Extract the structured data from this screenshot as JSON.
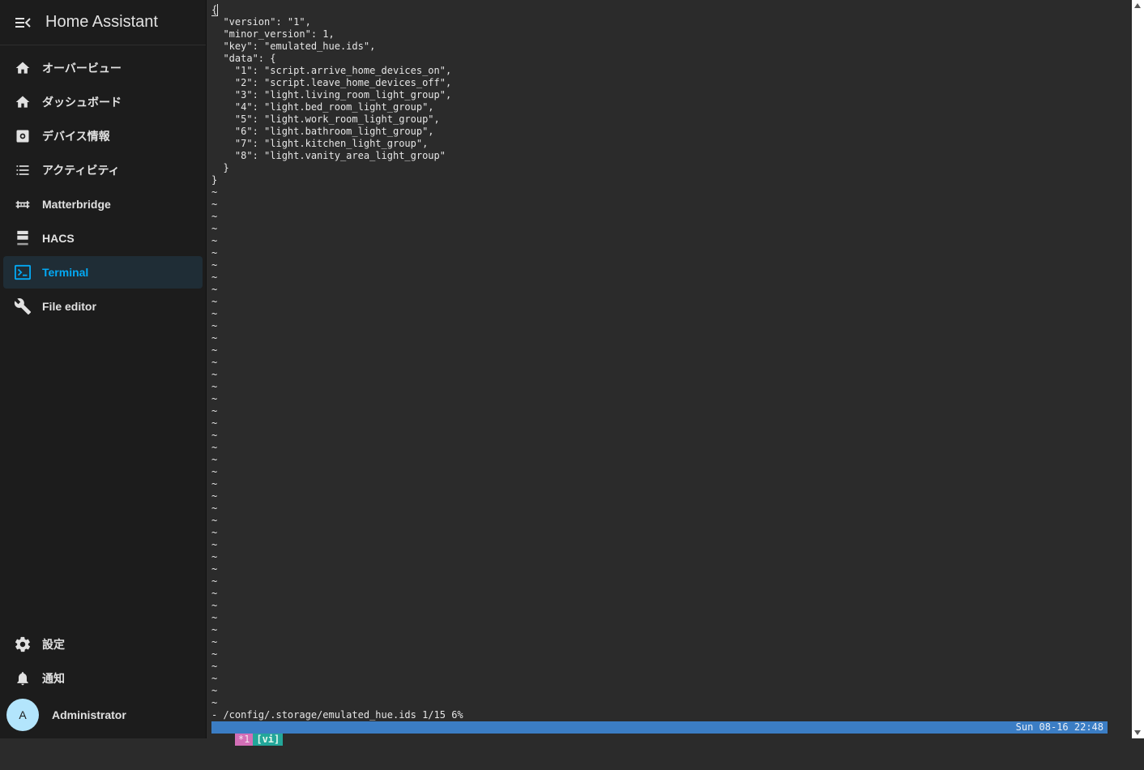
{
  "app": {
    "title": "Home Assistant"
  },
  "sidebar": {
    "items": [
      {
        "label": "オーバービュー",
        "icon": "home-icon",
        "active": false
      },
      {
        "label": "ダッシュボード",
        "icon": "home-icon",
        "active": false
      },
      {
        "label": "デバイス情報",
        "icon": "device-info-icon",
        "active": false
      },
      {
        "label": "アクティビティ",
        "icon": "list-icon",
        "active": false
      },
      {
        "label": "Matterbridge",
        "icon": "bridge-icon",
        "active": false
      },
      {
        "label": "HACS",
        "icon": "hacs-icon",
        "active": false
      },
      {
        "label": "Terminal",
        "icon": "terminal-icon",
        "active": true
      },
      {
        "label": "File editor",
        "icon": "wrench-icon",
        "active": false
      }
    ],
    "bottom": {
      "settings_label": "設定",
      "notifications_label": "通知",
      "user_name": "Administrator",
      "avatar_initial": "A"
    }
  },
  "terminal": {
    "file_lines": [
      "{",
      "  \"version\": \"1\",",
      "  \"minor_version\": 1,",
      "  \"key\": \"emulated_hue.ids\",",
      "  \"data\": {",
      "    \"1\": \"script.arrive_home_devices_on\",",
      "    \"2\": \"script.leave_home_devices_off\",",
      "    \"3\": \"light.living_room_light_group\",",
      "    \"4\": \"light.bed_room_light_group\",",
      "    \"5\": \"light.work_room_light_group\",",
      "    \"6\": \"light.bathroom_light_group\",",
      "    \"7\": \"light.kitchen_light_group\",",
      "    \"8\": \"light.vanity_area_light_group\"",
      "  }",
      "}"
    ],
    "empty_line_marker": "~",
    "empty_line_count": 43,
    "vi_status": "- /config/.storage/emulated_hue.ids 1/15 6%",
    "tmux": {
      "window": "*1",
      "mode": "[vi]",
      "clock": "Sun 08-16 22:48"
    }
  },
  "colors": {
    "sidebar_bg": "#1c1c1c",
    "terminal_bg": "#2b2b2b",
    "accent": "#03a9f4",
    "tmux_bar": "#3b7dc4"
  }
}
